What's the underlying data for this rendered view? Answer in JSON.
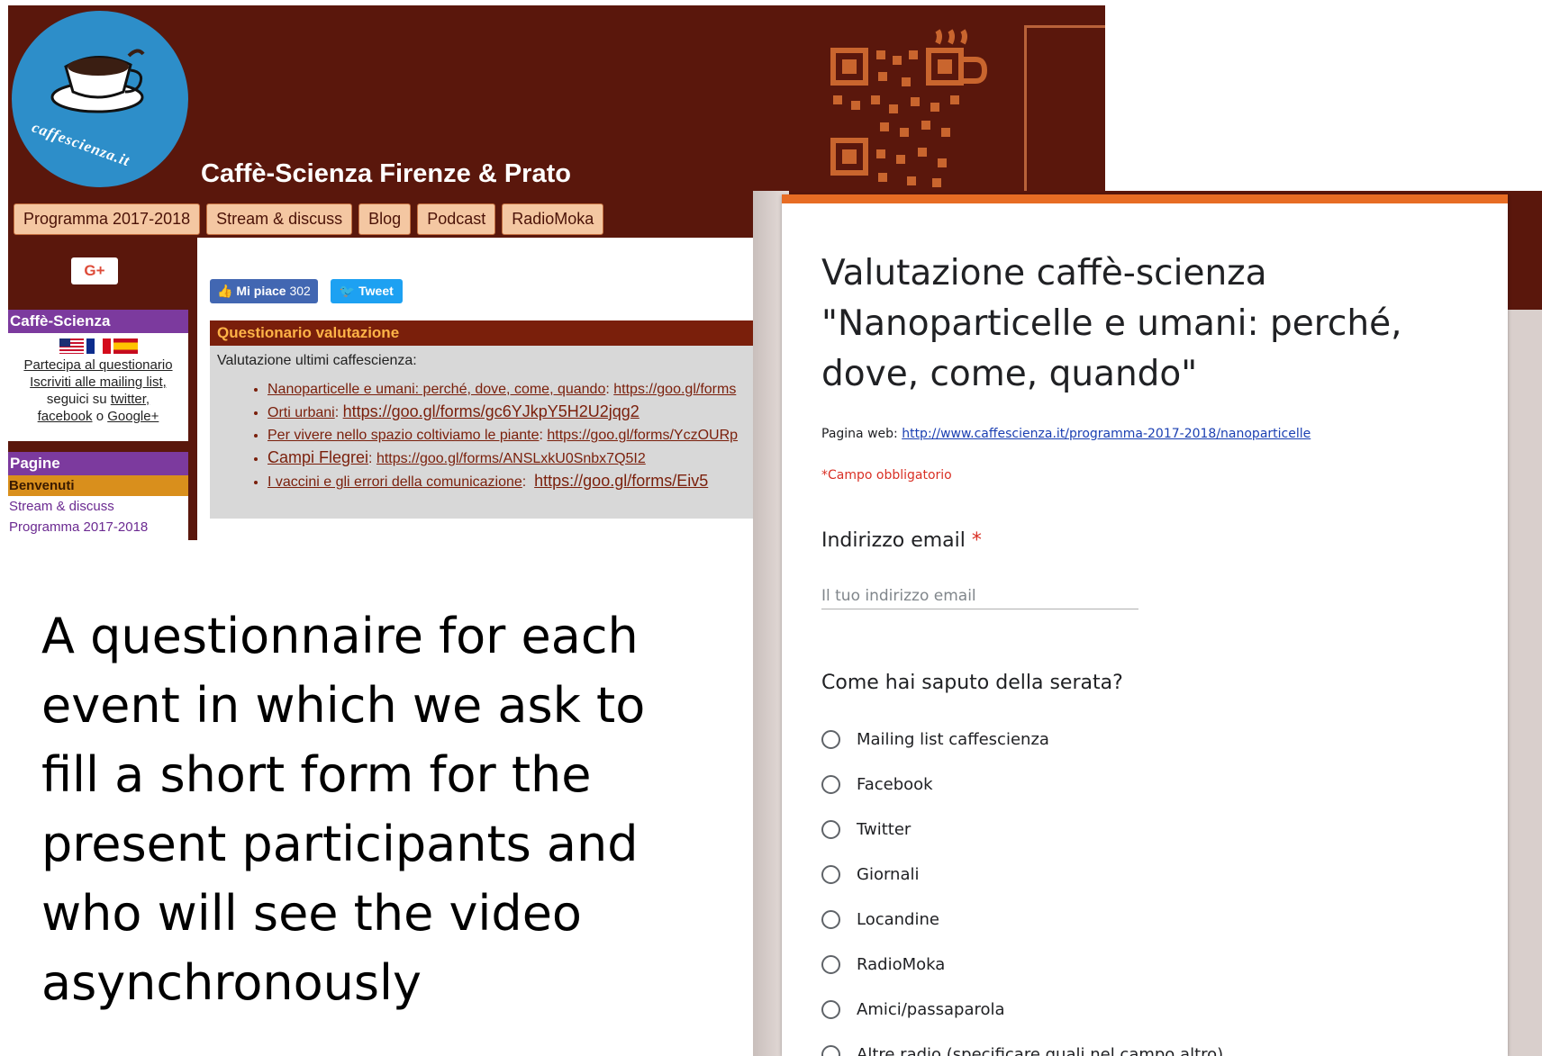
{
  "website": {
    "logo_text": "caffescienza.it",
    "title": "Caffè-Scienza Firenze & Prato",
    "nav": [
      "Programma 2017-2018",
      "Stream & discuss",
      "Blog",
      "Podcast",
      "RadioMoka"
    ],
    "gplus_label": "G+",
    "sidebar": {
      "caffe_header": "Caffè-Scienza",
      "participate_link": "Partecipa al questionario",
      "mailing_link": "Iscriviti alle mailing list,",
      "follow_prefix": "seguici su",
      "twitter_link": "twitter,",
      "facebook_link": "facebook",
      "or_text": "o",
      "google_link": "Google+",
      "pages_header": "Pagine",
      "pages": [
        "Benvenuti",
        "Stream & discuss",
        "Programma 2017-2018"
      ]
    },
    "social": {
      "like_label": "Mi piace",
      "like_count": "302",
      "tweet_label": "Tweet"
    },
    "questionnaire": {
      "header": "Questionario valutazione",
      "intro": "Valutazione ultimi caffescienza:",
      "items": [
        {
          "title": "Nanoparticelle e umani: perché, dove, come, quando",
          "sep": ":",
          "link": "https://goo.gl/forms"
        },
        {
          "title": "Orti urbani",
          "sep": ":",
          "link": "https://goo.gl/forms/gc6YJkpY5H2U2jqg2"
        },
        {
          "title": "Per vivere nello spazio coltiviamo le piante",
          "sep": ":",
          "link": "https://goo.gl/forms/YczOURp"
        },
        {
          "title": "Campi Flegrei",
          "sep": ":",
          "link": "https://goo.gl/forms/ANSLxkU0Snbx7Q5I2"
        },
        {
          "title": "I vaccini e gli errori della comunicazione",
          "sep": ":",
          "link": "https://goo.gl/forms/Eiv5"
        }
      ]
    }
  },
  "caption": "A questionnaire for each event in which we ask to fill a short form for the present participants and who will see the video asynchronously",
  "form": {
    "accent_color": "#e76c24",
    "title": "Valutazione caffè-scienza \"Nanoparticelle e umani: perché, dove, come, quando\"",
    "web_label": "Pagina web:",
    "web_link": "http://www.caffescienza.it/programma-2017-2018/nanoparticelle",
    "required_note": "*Campo obbligatorio",
    "email_question": "Indirizzo email",
    "email_required_mark": "*",
    "email_placeholder": "Il tuo indirizzo email",
    "email_value": "",
    "source_question": "Come hai saputo della serata?",
    "options": [
      "Mailing list caffescienza",
      "Facebook",
      "Twitter",
      "Giornali",
      "Locandine",
      "RadioMoka",
      "Amici/passaparola",
      "Altre radio (specificare quali nel campo altro)"
    ]
  }
}
